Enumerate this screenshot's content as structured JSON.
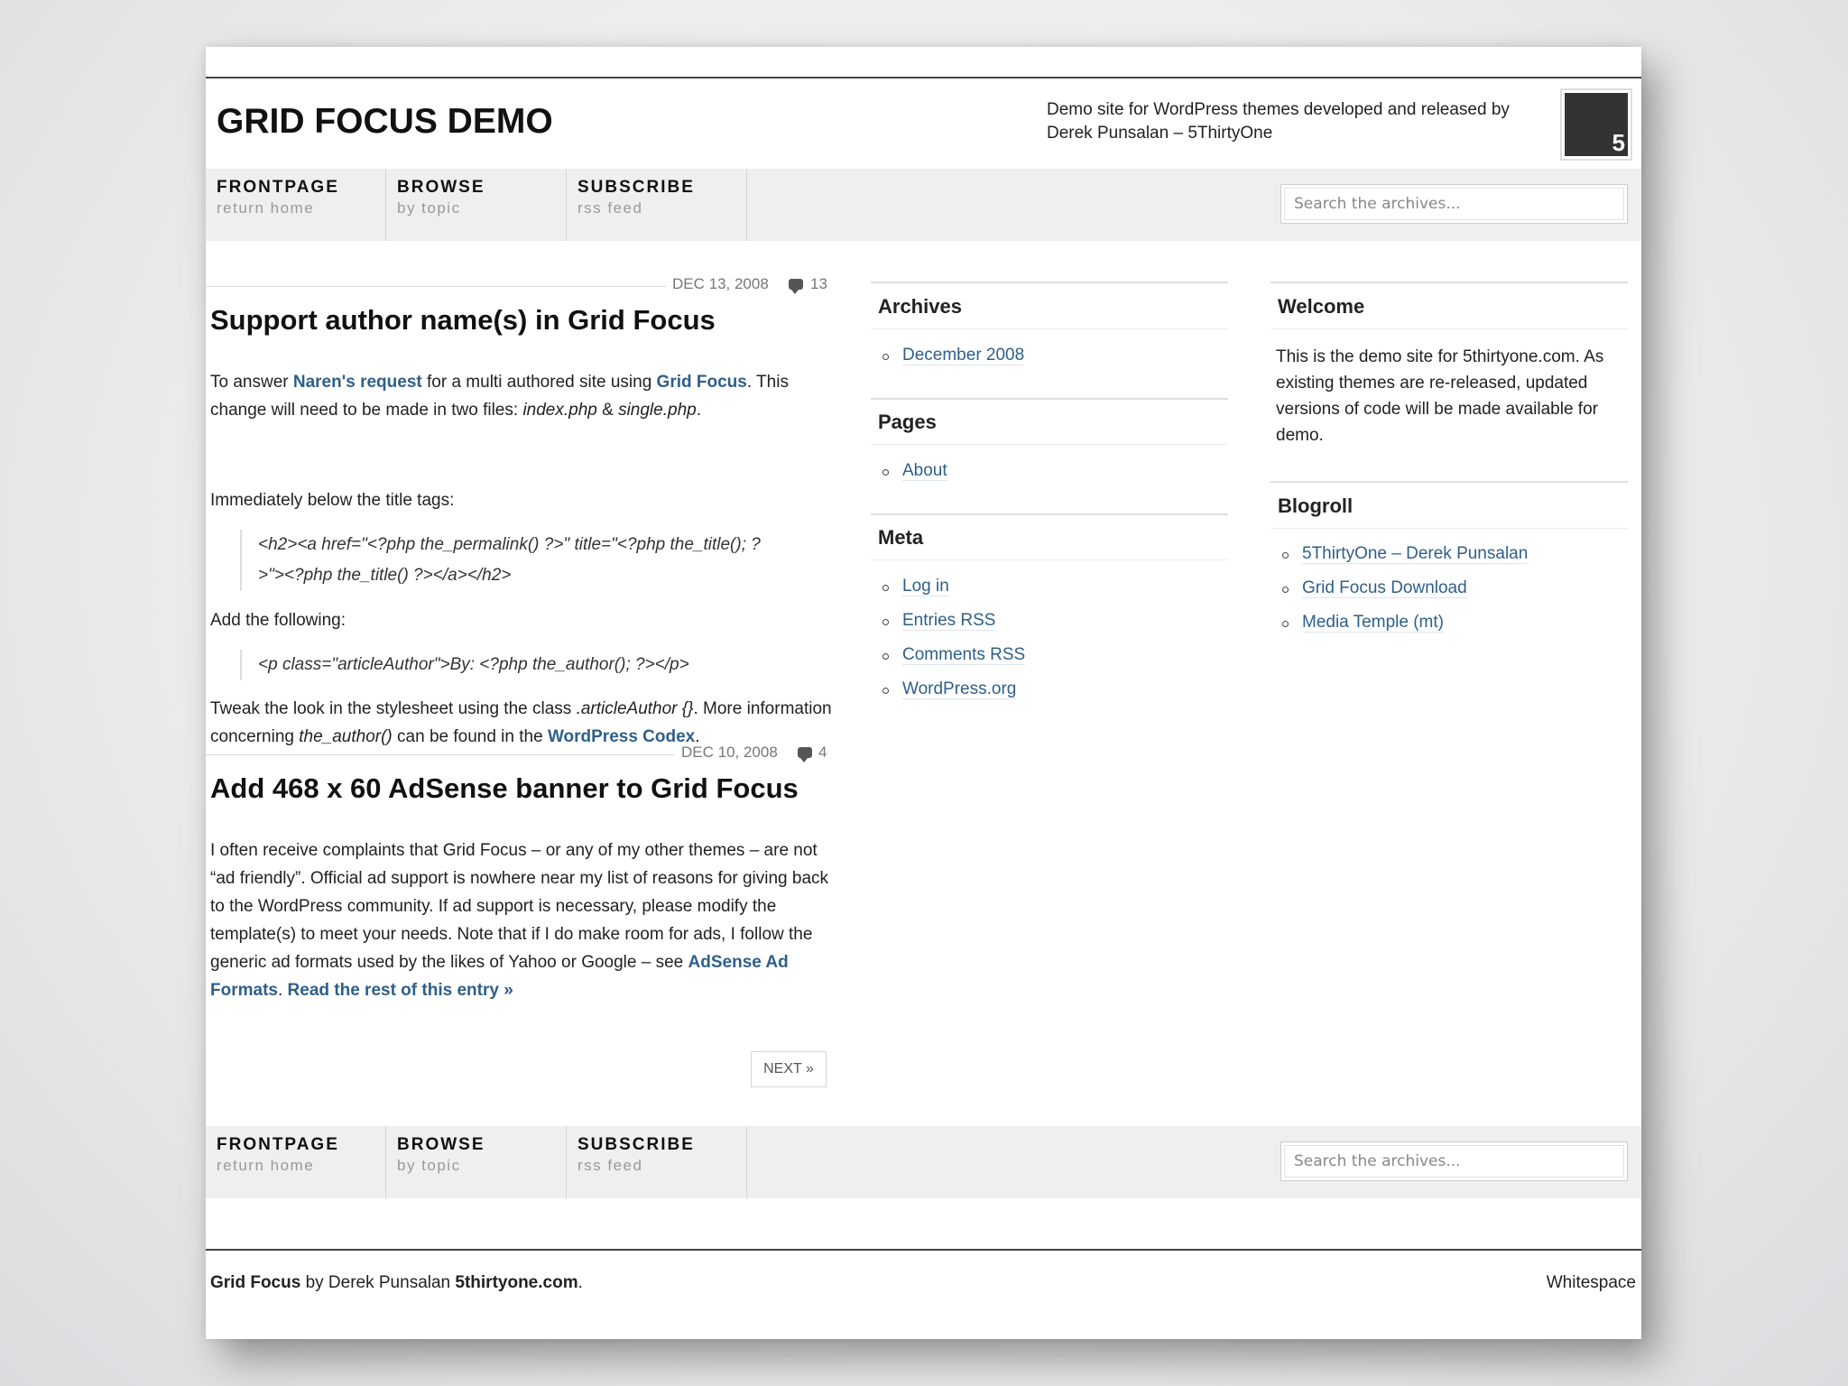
{
  "header": {
    "title": "GRID FOCUS DEMO",
    "description": "Demo site for WordPress themes developed and released by Derek Punsalan – 5ThirtyOne",
    "logo_text": "5"
  },
  "nav": {
    "items": [
      {
        "title": "FRONTPAGE",
        "sub": "return home"
      },
      {
        "title": "BROWSE",
        "sub": "by topic"
      },
      {
        "title": "SUBSCRIBE",
        "sub": "rss feed"
      }
    ],
    "search_placeholder": "Search the archives..."
  },
  "posts": [
    {
      "date": "DEC 13, 2008",
      "comments": "13",
      "title": "Support author name(s) in Grid Focus",
      "p1_a": "To answer ",
      "p1_link1": "Naren's request",
      "p1_b": " for a multi authored site using ",
      "p1_link2": "Grid Focus",
      "p1_c": ". This change will need to be made in two files: ",
      "p1_file1": "index.php",
      "p1_amp": " & ",
      "p1_file2": "single.php",
      "p1_end": ".",
      "p2": "Immediately below the title tags:",
      "code1": "<h2><a href=\"<?php the_permalink() ?>\" title=\"<?php the_title(); ?>\"><?php the_title() ?></a></h2>",
      "p3": "Add the following:",
      "code2": "<p class=\"articleAuthor\">By: <?php the_author(); ?></p>",
      "p4_a": "Tweak the look in the stylesheet using the class ",
      "p4_class": ".articleAuthor {}",
      "p4_b": ". More information concerning ",
      "p4_fn": "the_author()",
      "p4_c": " can be found in the ",
      "p4_link": "WordPress Codex",
      "p4_end": "."
    },
    {
      "date": "DEC 10, 2008",
      "comments": "4",
      "title": "Add 468 x 60 AdSense banner to Grid Focus",
      "body": "I often receive complaints that Grid Focus – or any of my other themes – are not “ad friendly”. Official ad support is nowhere near my list of reasons for giving back to the WordPress community. If ad support is necessary, please modify the template(s) to meet your needs. Note that if I do make room for ads, I follow the generic ad formats used by the likes of Yahoo or Google – see ",
      "link1": "AdSense Ad Formats",
      "sep": ". ",
      "link2": "Read the rest of this entry »"
    }
  ],
  "next_label": "NEXT »",
  "sidebar_mid": {
    "archives_title": "Archives",
    "archives": [
      "December 2008"
    ],
    "pages_title": "Pages",
    "pages": [
      "About"
    ],
    "meta_title": "Meta",
    "meta": [
      "Log in",
      "Entries RSS",
      "Comments RSS",
      "WordPress.org"
    ]
  },
  "sidebar_right": {
    "welcome_title": "Welcome",
    "welcome_text": "This is the demo site for 5thirtyone.com. As existing themes are re-released, updated versions of code will be made available for demo.",
    "blogroll_title": "Blogroll",
    "blogroll": [
      "5ThirtyOne – Derek Punsalan",
      "Grid Focus Download",
      "Media Temple (mt)"
    ]
  },
  "footer": {
    "theme": "Grid Focus",
    "by": " by Derek Punsalan ",
    "site": "5thirtyone.com",
    "dot": ".",
    "right": "Whitespace"
  }
}
